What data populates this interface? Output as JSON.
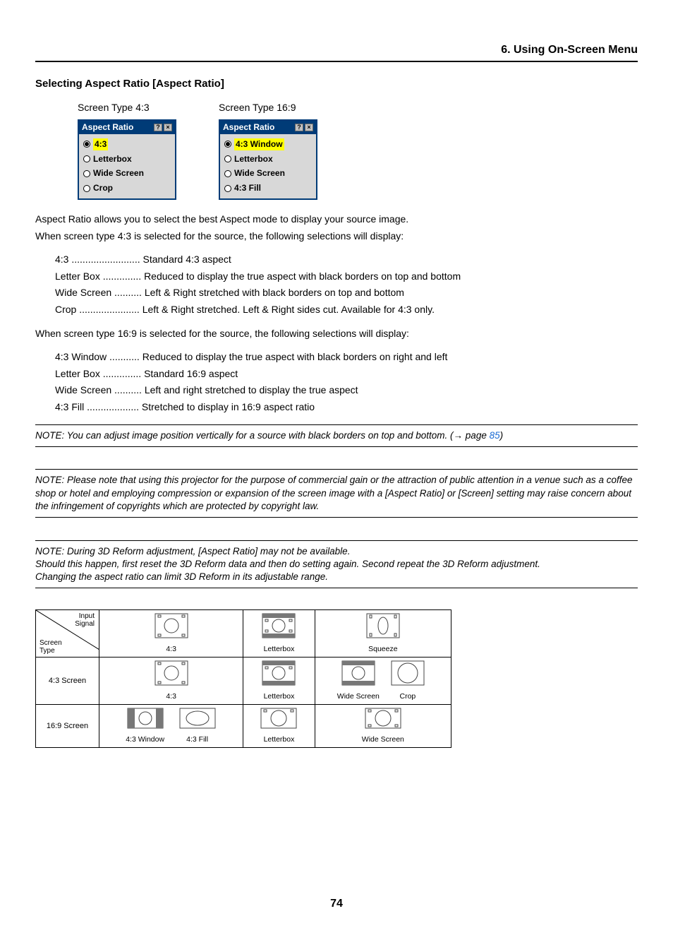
{
  "header": {
    "title": "6. Using On-Screen Menu"
  },
  "section": {
    "title": "Selecting Aspect Ratio [Aspect Ratio]"
  },
  "screenshots": {
    "col1": {
      "label": "Screen Type 4:3",
      "osd_title": "Aspect Ratio",
      "options": [
        "4:3",
        "Letterbox",
        "Wide Screen",
        "Crop"
      ],
      "selected": 0
    },
    "col2": {
      "label": "Screen Type 16:9",
      "osd_title": "Aspect Ratio",
      "options": [
        "4:3 Window",
        "Letterbox",
        "Wide Screen",
        "4:3 Fill"
      ],
      "selected": 0
    }
  },
  "intro": {
    "p1": "Aspect Ratio allows you to select the best Aspect mode to display your source image.",
    "p2": "When screen type 4:3 is selected for the source, the following selections will display:"
  },
  "defs43": [
    {
      "term": "4:3 ......................... ",
      "desc": "Standard 4:3 aspect"
    },
    {
      "term": "Letter Box .............. ",
      "desc": "Reduced to display the true aspect with black borders on top and bottom"
    },
    {
      "term": "Wide Screen .......... ",
      "desc": "Left & Right stretched with black borders on top and bottom"
    },
    {
      "term": "Crop ...................... ",
      "desc": "Left & Right stretched. Left & Right sides cut. Available for 4:3 only."
    }
  ],
  "intro169": "When screen type 16:9 is selected for the source, the following selections will display:",
  "defs169": [
    {
      "term": "4:3 Window ........... ",
      "desc": "Reduced to display the true aspect with black borders on right and left"
    },
    {
      "term": "Letter Box .............. ",
      "desc": "Standard 16:9 aspect"
    },
    {
      "term": "Wide Screen .......... ",
      "desc": "Left and right stretched to display the true aspect"
    },
    {
      "term": "4:3 Fill ................... ",
      "desc": "Stretched to display in 16:9 aspect ratio"
    }
  ],
  "notes": {
    "n1a": "NOTE: You can adjust image position vertically for a source with black borders on top and bottom. (→ page ",
    "n1_link": "85",
    "n1b": ")",
    "n2": "NOTE: Please note that using this projector for the purpose of commercial gain or the attraction of public attention in a venue such as a coffee shop or hotel and employing compression or expansion of the screen image with a [Aspect Ratio] or [Screen] setting may raise concern about the infringement of copyrights which are protected by copyright law.",
    "n3a": "NOTE: During 3D Reform adjustment, [Aspect Ratio] may not be available.",
    "n3b": "Should this happen, first reset the 3D Reform data and then do setting again. Second repeat the 3D Reform adjustment.",
    "n3c": "Changing the aspect ratio can limit 3D Reform in its adjustable range."
  },
  "table": {
    "diag_top": "Input\nSignal",
    "diag_bot": "Screen\nType",
    "headers": [
      "4:3",
      "Letterbox",
      "Squeeze"
    ],
    "rows": [
      {
        "label": "4:3 Screen",
        "cells": [
          "4:3",
          "Letterbox",
          [
            "Wide Screen",
            "Crop"
          ]
        ]
      },
      {
        "label": "16:9 Screen",
        "cells": [
          [
            "4:3 Window",
            "4:3 Fill"
          ],
          "Letterbox",
          "Wide Screen"
        ]
      }
    ]
  },
  "page_number": "74"
}
